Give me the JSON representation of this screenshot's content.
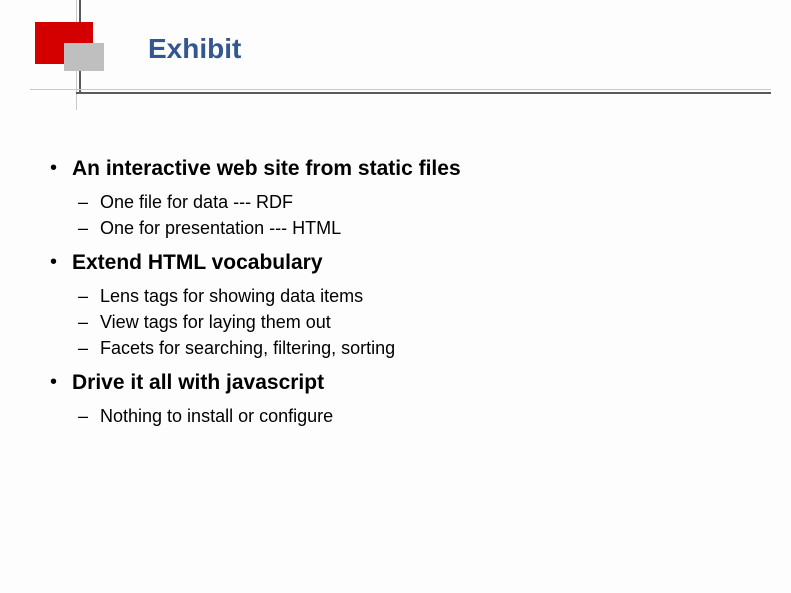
{
  "title": "Exhibit",
  "bullets": [
    {
      "text": "An interactive web site from static files",
      "sub": [
        "One file for data --- RDF",
        "One for presentation --- HTML"
      ]
    },
    {
      "text": "Extend HTML vocabulary",
      "sub": [
        "Lens tags for showing data items",
        "View tags for laying them out",
        "Facets for searching, filtering, sorting"
      ]
    },
    {
      "text": "Drive it all with javascript",
      "sub": [
        "Nothing to install or configure"
      ]
    }
  ]
}
